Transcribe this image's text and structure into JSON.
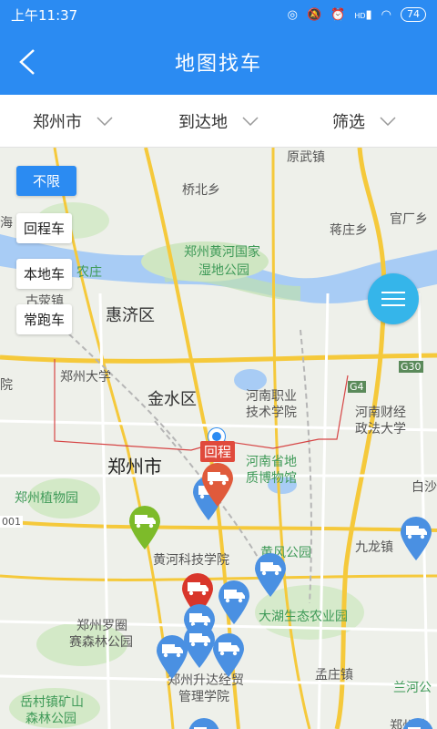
{
  "status_bar": {
    "time": "上午11:37",
    "battery": "74",
    "signal_text": "HD"
  },
  "header": {
    "title": "地图找车",
    "back_icon": "chevron-left-icon"
  },
  "filters": [
    {
      "label": "郑州市",
      "icon": "chevron-down-icon"
    },
    {
      "label": "到达地",
      "icon": "chevron-down-icon"
    },
    {
      "label": "筛选",
      "icon": "chevron-down-icon"
    }
  ],
  "vehicle_types": [
    {
      "label": "不限",
      "selected": true
    },
    {
      "label": "回程车",
      "selected": false
    },
    {
      "label": "本地车",
      "selected": false
    },
    {
      "label": "常跑车",
      "selected": false
    }
  ],
  "map": {
    "labels": {
      "yuanwu": "原武镇",
      "qiaobei": "桥北乡",
      "hai": "海",
      "jiangzhuang": "蒋庄乡",
      "guanchang": "官厂乡",
      "wetland1": "郑州黄河国家",
      "wetland2": "湿地公园",
      "nongzhuang": "农庄",
      "gusheng": "古荥镇",
      "huiji": "惠济区",
      "zzu": "郑州大学",
      "yuan": "院",
      "g30": "G30",
      "g4": "G4",
      "jinshui": "金水区",
      "hnvoc1": "河南职业",
      "hnvoc2": "技术学院",
      "hnfin1": "河南财经",
      "hnfin2": "政法大学",
      "zhengzhou": "郑州市",
      "route": "回程",
      "geomuseum1": "河南省地",
      "geomuseum2": "质博物馆",
      "baisha": "白沙",
      "botanic": "郑州植物园",
      "r001": "001",
      "huanghe_tech": "黄河科技学院",
      "jiulong": "九龙镇",
      "huangfeng": "黄风公园",
      "dahu": "大湖生态农业园",
      "luoyuan1": "郑州罗圈",
      "luoyuan2": "赛森林公园",
      "shengda1": "郑州升达经贸",
      "shengda2": "管理学院",
      "mengzhuang": "孟庄镇",
      "lanhe": "兰河公",
      "yuecun1": "岳村镇矿山",
      "yuecun2": "森林公园",
      "zhengzhou_short": "郑州航"
    },
    "truck_pins": [
      {
        "color": "#4a90e2"
      },
      {
        "color": "#e05a3b"
      },
      {
        "color": "#7dbb2a"
      },
      {
        "color": "#4a90e2"
      },
      {
        "color": "#4a90e2"
      },
      {
        "color": "#4a90e2"
      },
      {
        "color": "#d9362b"
      },
      {
        "color": "#4a90e2"
      },
      {
        "color": "#4a90e2"
      },
      {
        "color": "#4a90e2"
      },
      {
        "color": "#4a90e2"
      },
      {
        "color": "#4a90e2"
      },
      {
        "color": "#4a90e2"
      }
    ],
    "menu_icon": "menu-icon"
  }
}
